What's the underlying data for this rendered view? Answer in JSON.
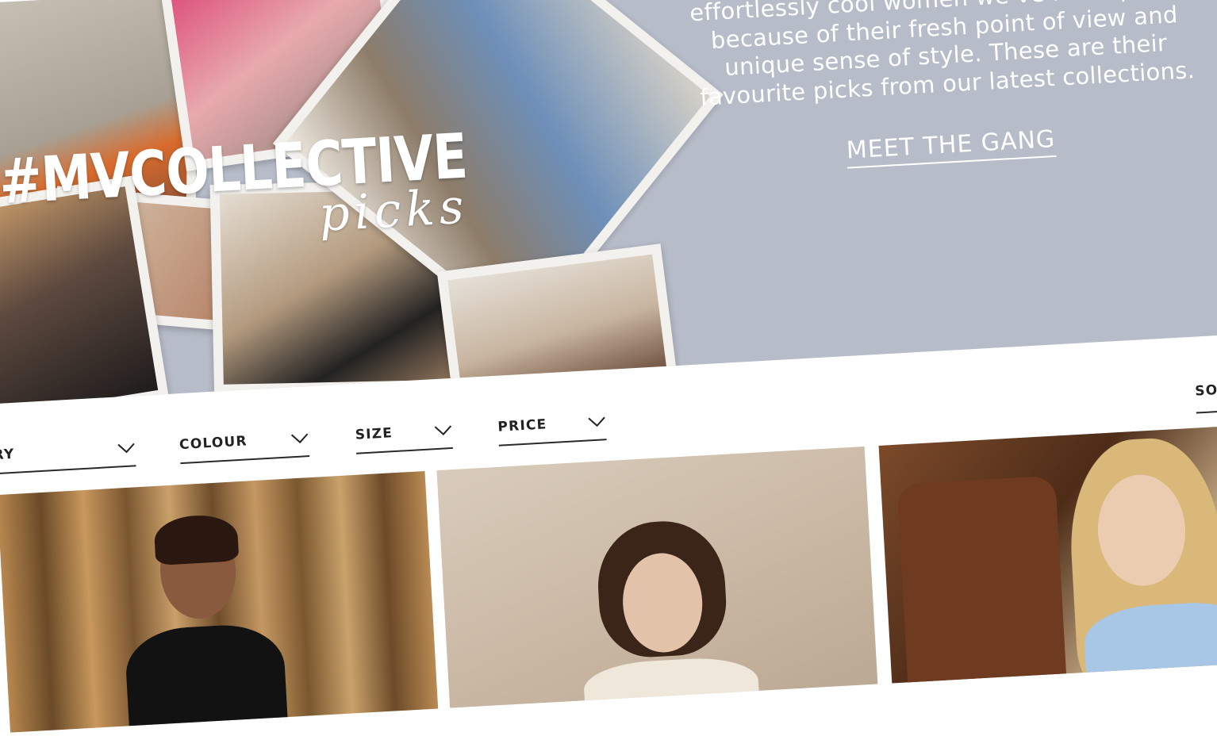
{
  "hero": {
    "title": "#MVCOLLECTIVE",
    "script": "picks",
    "blurb": "Meet the #MVCollective – a set of effortlessly cool women we’ve hand-picked because of their fresh point of view and unique sense of style. These are their favourite picks from our latest collections.",
    "cta": "MEET THE GANG"
  },
  "filters": {
    "category": "CATEGORY",
    "colour": "COLOUR",
    "size": "SIZE",
    "price": "PRICE",
    "sort": "SORT"
  },
  "icons": {
    "filter_toggle": "chevron-down-icon"
  },
  "colors": {
    "hero_background": "#b6bcc8",
    "text_dark": "#222222",
    "hero_text": "#ffffff"
  }
}
